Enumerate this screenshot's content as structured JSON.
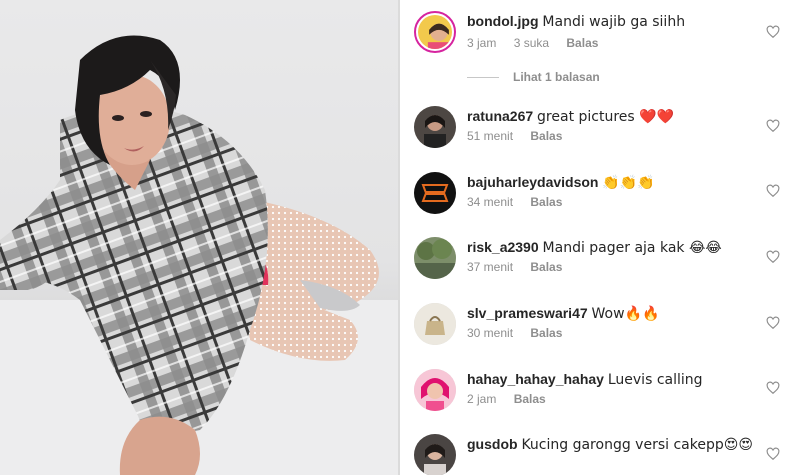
{
  "comments": [
    {
      "username": "bondol.jpg",
      "text": "Mandi wajib ga siihh",
      "time": "3 jam",
      "likes": "3 suka",
      "reply": "Balas",
      "view_replies": "Lihat 1 balasan",
      "avatar_icon": "profile-photo-story-ring"
    },
    {
      "username": "ratuna267",
      "text": "great pictures ❤️❤️",
      "time": "51 menit",
      "reply": "Balas",
      "avatar_icon": "profile-photo"
    },
    {
      "username": "bajuharleydavidson",
      "text": "👏👏👏",
      "time": "34 menit",
      "reply": "Balas",
      "avatar_icon": "harley-davidson-logo"
    },
    {
      "username": "risk_a2390",
      "text": "Mandi pager aja kak 😂😂",
      "time": "37 menit",
      "reply": "Balas",
      "avatar_icon": "profile-photo"
    },
    {
      "username": "slv_prameswari47",
      "text": "Wow🔥🔥",
      "time": "30 menit",
      "reply": "Balas",
      "avatar_icon": "profile-photo"
    },
    {
      "username": "hahay_hahay_hahay",
      "text": "Luevis calling",
      "time": "2 jam",
      "reply": "Balas",
      "avatar_icon": "profile-photo"
    },
    {
      "username": "gusdob",
      "text": "Kucing garongg versi cakepp😍😍",
      "avatar_icon": "profile-photo"
    }
  ],
  "colors": {
    "username": "#262626",
    "meta": "#8e8e8e",
    "story_ring": "#d6249f"
  }
}
